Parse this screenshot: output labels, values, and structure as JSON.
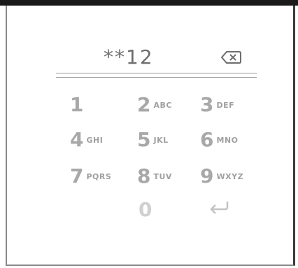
{
  "display": {
    "value": "**12"
  },
  "icons": {
    "backspace": "backspace-icon",
    "enter": "enter-icon"
  },
  "keypad": {
    "rows": [
      [
        {
          "digit": "1",
          "letters": ""
        },
        {
          "digit": "2",
          "letters": "ABC"
        },
        {
          "digit": "3",
          "letters": "DEF"
        }
      ],
      [
        {
          "digit": "4",
          "letters": "GHI"
        },
        {
          "digit": "5",
          "letters": "JKL"
        },
        {
          "digit": "6",
          "letters": "MNO"
        }
      ],
      [
        {
          "digit": "7",
          "letters": "PQRS"
        },
        {
          "digit": "8",
          "letters": "TUV"
        },
        {
          "digit": "9",
          "letters": "WXYZ"
        }
      ],
      [
        {
          "digit": "0",
          "letters": ""
        }
      ]
    ]
  }
}
